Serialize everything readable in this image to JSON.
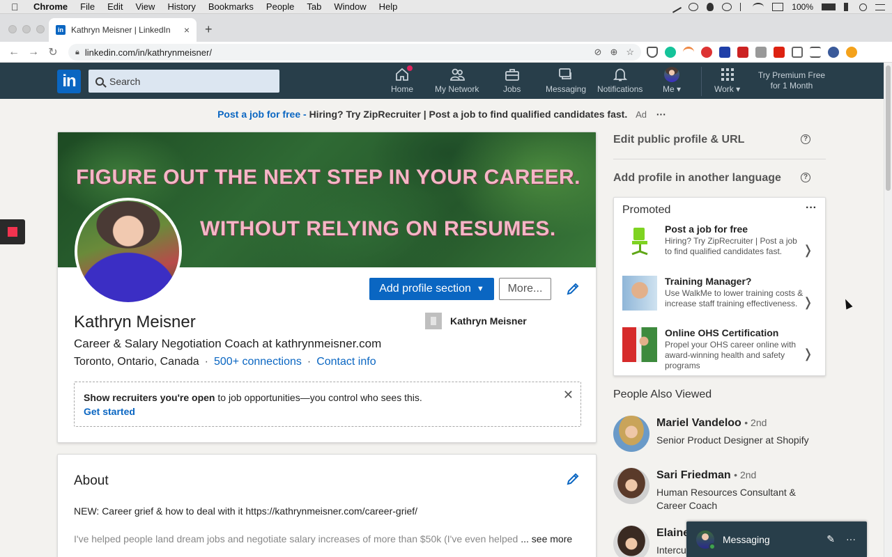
{
  "macbar": {
    "items": [
      "Chrome",
      "File",
      "Edit",
      "View",
      "History",
      "Bookmarks",
      "People",
      "Tab",
      "Window",
      "Help"
    ],
    "battery": "100%"
  },
  "browser": {
    "tab_title": "Kathryn Meisner | LinkedIn",
    "url": "linkedin.com/in/kathrynmeisner/"
  },
  "linkedin_nav": {
    "logo": "in",
    "search_placeholder": "Search",
    "items": [
      {
        "label": "Home",
        "icon": "home-icon"
      },
      {
        "label": "My Network",
        "icon": "network-icon"
      },
      {
        "label": "Jobs",
        "icon": "briefcase-icon"
      },
      {
        "label": "Messaging",
        "icon": "chat-icon"
      },
      {
        "label": "Notifications",
        "icon": "bell-icon"
      },
      {
        "label": "Me",
        "icon": "avatar"
      },
      {
        "label": "Work",
        "icon": "grid-icon"
      }
    ],
    "premium_line1": "Try Premium Free",
    "premium_line2": "for 1 Month"
  },
  "ad_banner": {
    "link": "Post a job for free -",
    "text": "Hiring? Try ZipRecruiter | Post a job to find qualified candidates fast.",
    "tag": "Ad",
    "dots": "···"
  },
  "profile": {
    "banner_line1": "FIGURE OUT THE NEXT STEP IN YOUR CAREER.",
    "banner_line2": "WITHOUT RELYING ON RESUMES.",
    "add_section_label": "Add profile section",
    "more_label": "More...",
    "name": "Kathryn Meisner",
    "headline": "Career & Salary Negotiation Coach at kathrynmeisner.com",
    "location": "Toronto, Ontario, Canada",
    "sep": "·",
    "connections": "500+ connections",
    "contact_info": "Contact info",
    "company": "Kathryn Meisner",
    "open_bold": "Show recruiters you're open",
    "open_rest": " to job opportunities—you control who sees this.",
    "open_link": "Get started",
    "close_glyph": "✕"
  },
  "about": {
    "title": "About",
    "p1": "NEW: Career grief & how to deal with it https://kathrynmeisner.com/career-grief/",
    "p2": "I've helped people land dream jobs and negotiate salary increases of more than $50k (I've even helped",
    "see_more": "... see more"
  },
  "rail": {
    "edit_public": "Edit public profile & URL",
    "add_language": "Add profile in another language",
    "help_glyph": "?",
    "promoted_title": "Promoted",
    "promoted_dots": "···",
    "promos": [
      {
        "title": "Post a job for free",
        "desc": "Hiring? Try ZipRecruiter | Post a job to find qualified candidates fast."
      },
      {
        "title": "Training Manager?",
        "desc": "Use WalkMe to lower training costs & increase staff training effectiveness."
      },
      {
        "title": "Online OHS Certification",
        "desc": "Propel your OHS career online with award-winning health and safety programs"
      }
    ],
    "chevron": "❭",
    "people_title": "People Also Viewed",
    "people": [
      {
        "name": "Mariel Vandeloo",
        "degree": "• 2nd",
        "headline": "Senior Product Designer at Shopify"
      },
      {
        "name": "Sari Friedman",
        "degree": "• 2nd",
        "headline": "Human Resources Consultant & Career Coach"
      },
      {
        "name": "Elaine",
        "degree": "",
        "headline": "Intercu"
      }
    ]
  },
  "messaging": {
    "label": "Messaging",
    "compose_glyph": "✎",
    "dots": "···"
  },
  "colors": {
    "linkedin_blue": "#0a66c2",
    "nav_bg": "#283e4a",
    "banner_text": "#f4b6c6"
  }
}
